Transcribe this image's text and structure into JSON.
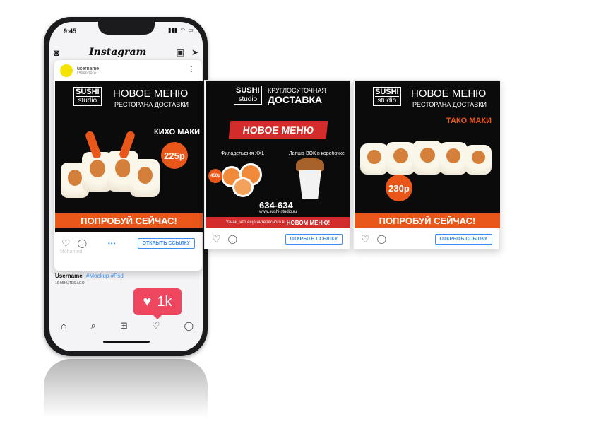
{
  "status": {
    "time": "9:45"
  },
  "app": {
    "title": "Instagram"
  },
  "post": {
    "username": "username",
    "subtitle": "Placehore",
    "caption_user": "Username",
    "hashtags": "#Mockup #Psd",
    "time_ago": "10 MINUTES AGO",
    "blurred_name": "Mohamed"
  },
  "ad1": {
    "brand_top": "SUSHI",
    "brand_bottom": "studio",
    "title": "НОВОЕ МЕНЮ",
    "subtitle": "РЕСТОРАНА ДОСТАВКИ",
    "product": "КИХО МАКИ",
    "price": "225р",
    "cta": "ПОПРОБУЙ СЕЙЧАС!"
  },
  "ad2": {
    "brand_top": "SUSHI",
    "brand_bottom": "studio",
    "title_top": "КРУГЛОСУТОЧНАЯ",
    "title": "ДОСТАВКА",
    "banner": "НОВОЕ МЕНЮ",
    "item1": "Филадельфия XXL",
    "item2": "Лапша-ВОК в коробочке",
    "sticker": "450р",
    "phone": "634-634",
    "site": "www.sushi-studio.ru",
    "footer_text": "Узнай, что ещё интересного в",
    "footer_bold": "НОВОМ МЕНЮ!"
  },
  "ad3": {
    "brand_top": "SUSHI",
    "brand_bottom": "studio",
    "title": "НОВОЕ МЕНЮ",
    "subtitle": "РЕСТОРАНА ДОСТАВКИ",
    "product": "ТАКО МАКИ",
    "price": "230р",
    "cta": "ПОПРОБУЙ СЕЙЧАС!"
  },
  "actions": {
    "link_label": "ОТКРЫТЬ ССЫЛКУ",
    "dots": "•••"
  },
  "notification": {
    "likes": "1k"
  },
  "colors": {
    "accent": "#e9561a",
    "link": "#3b8ef0",
    "like": "#ef4660",
    "banner": "#d42b2b"
  }
}
